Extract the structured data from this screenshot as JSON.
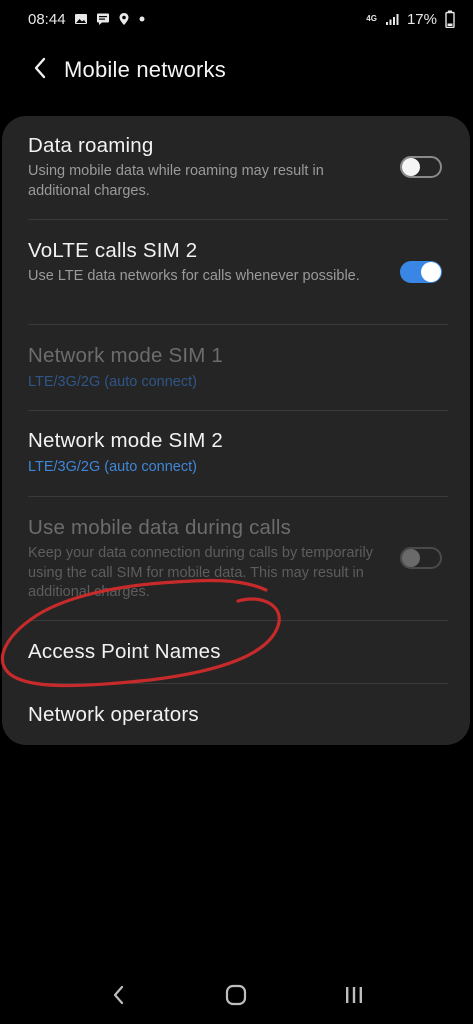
{
  "status_bar": {
    "time": "08:44",
    "network_type": "4G",
    "battery": "17%",
    "icons": [
      "image-icon",
      "message-icon",
      "location-icon",
      "dot-icon",
      "signal-icon",
      "battery-icon"
    ]
  },
  "header": {
    "back_icon": "back-arrow-icon",
    "title": "Mobile networks"
  },
  "settings": {
    "data_roaming": {
      "title": "Data roaming",
      "subtitle": "Using mobile data while roaming may result in additional charges.",
      "enabled": false
    },
    "volte": {
      "title": "VoLTE calls SIM 2",
      "subtitle": "Use LTE data networks for calls whenever possible.",
      "enabled": true
    },
    "network_mode_sim1": {
      "title": "Network mode SIM 1",
      "value": "LTE/3G/2G (auto connect)",
      "disabled": true
    },
    "network_mode_sim2": {
      "title": "Network mode SIM 2",
      "value": "LTE/3G/2G (auto connect)"
    },
    "mobile_data_during_calls": {
      "title": "Use mobile data during calls",
      "subtitle": "Keep your data connection during calls by temporarily using the call SIM for mobile data. This may result in additional charges.",
      "enabled": false,
      "disabled": true
    },
    "access_point_names": {
      "title": "Access Point Names"
    },
    "network_operators": {
      "title": "Network operators"
    }
  },
  "colors": {
    "background": "#000000",
    "card": "#252525",
    "accent_blue": "#3a86e5",
    "annotation_red": "#d42a2a"
  },
  "nav_bar": {
    "icons": [
      "back-icon",
      "home-icon",
      "recents-icon"
    ]
  }
}
